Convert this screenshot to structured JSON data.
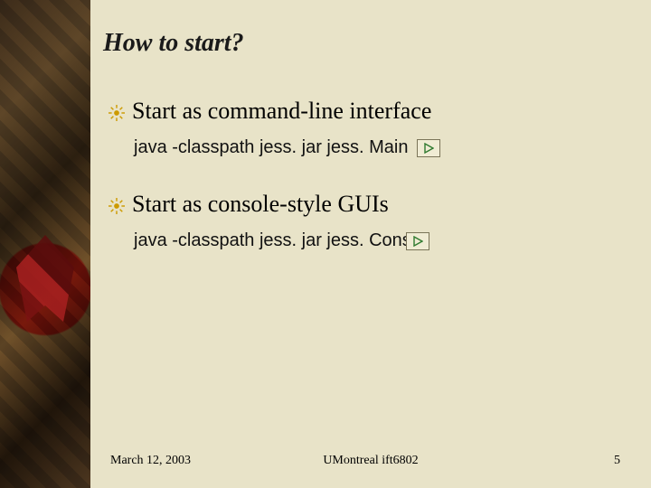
{
  "slide": {
    "title": "How to start?",
    "bullets": [
      {
        "heading": "Start as command-line interface",
        "code": "java -classpath jess. jar jess. Main"
      },
      {
        "heading": "Start as console-style GUIs",
        "code": "java -classpath jess. jar jess. Consc"
      }
    ],
    "footer": {
      "date": "March 12, 2003",
      "center": "UMontreal ift6802",
      "page": "5"
    }
  },
  "icons": {
    "bullet": "sun-burst",
    "action": "play-triangle"
  },
  "colors": {
    "background": "#e8e3c8",
    "accent_gold": "#cc9a00",
    "action_green": "#2f7a2f"
  }
}
